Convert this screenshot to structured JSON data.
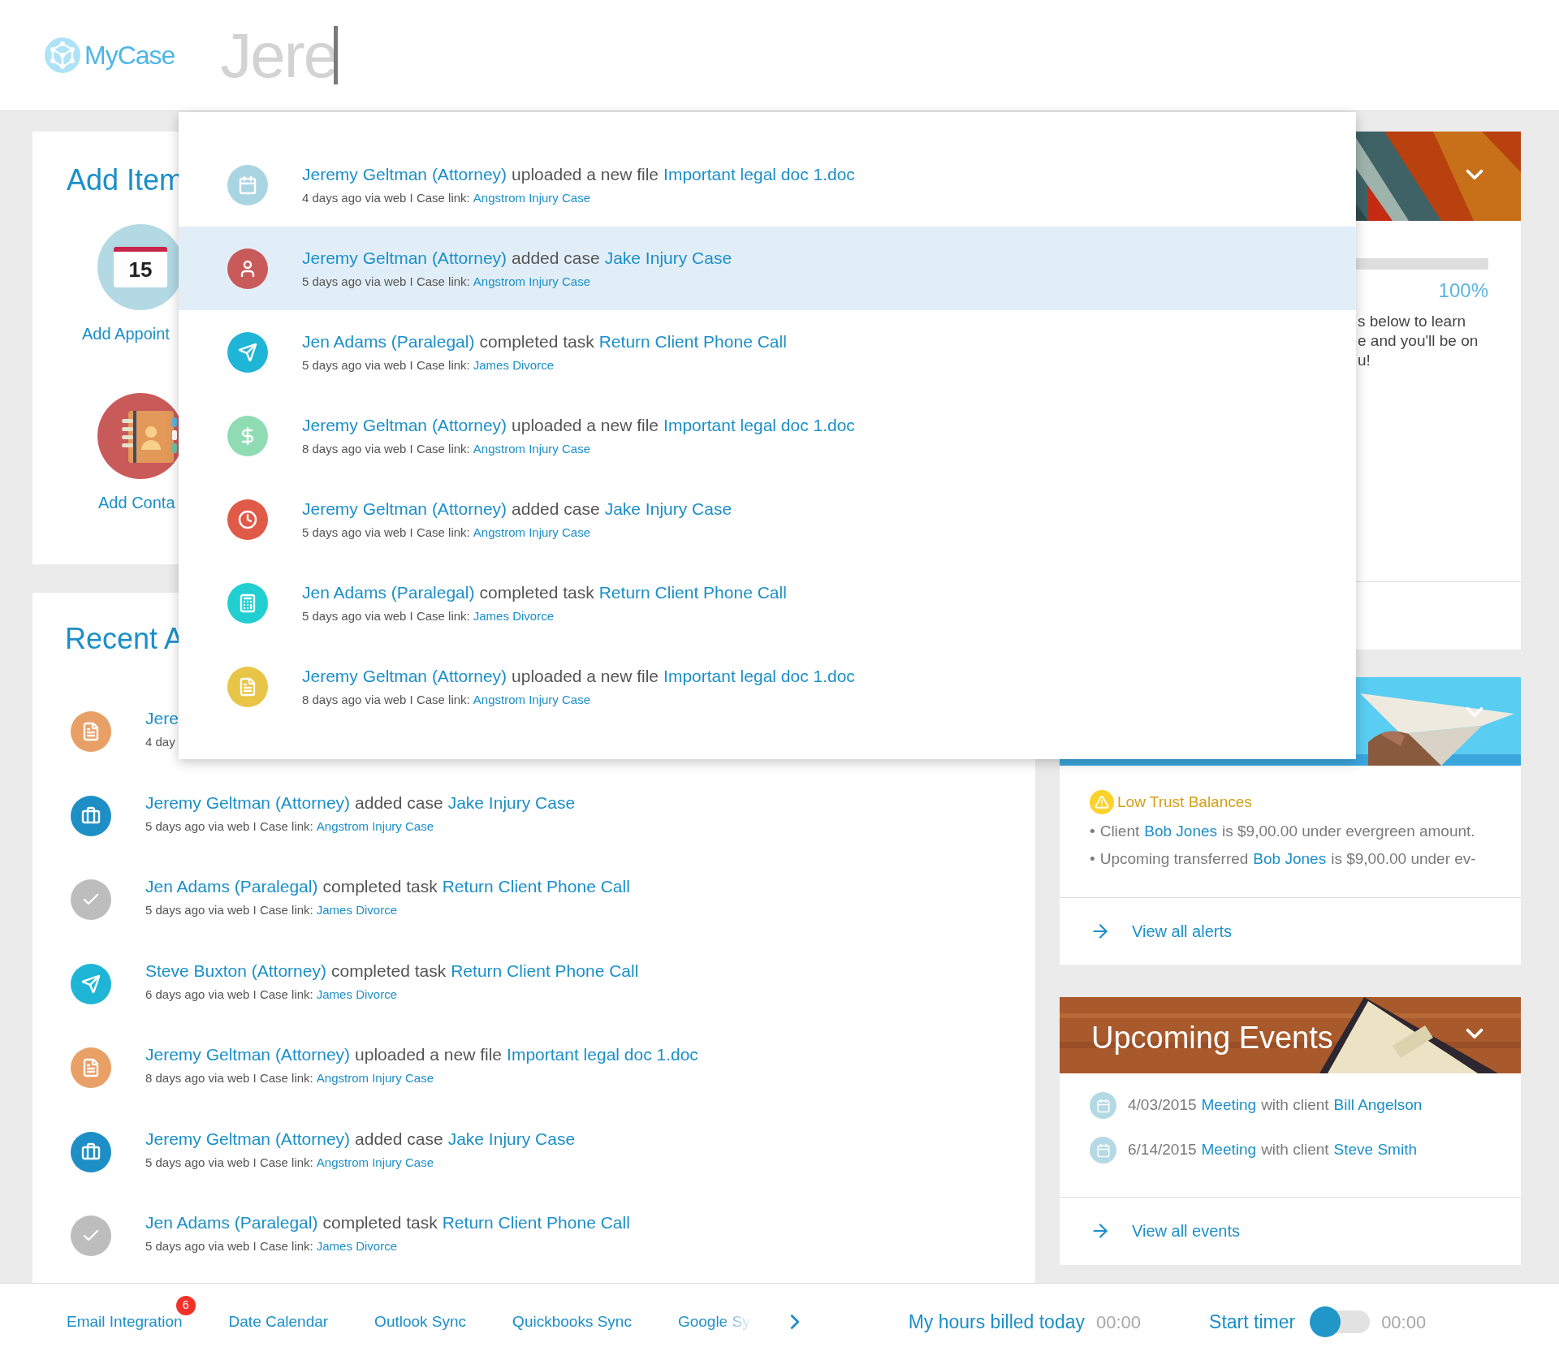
{
  "header": {
    "brand": "MyCase",
    "search": {
      "value": "Jere"
    }
  },
  "add_item": {
    "title": "Add Item",
    "items": [
      {
        "kind": "calendar",
        "day": "15",
        "label": "Add Appoint"
      },
      {
        "kind": "contacts",
        "label": "Add Conta"
      }
    ]
  },
  "recent_activity": {
    "title": "Recent A",
    "items": [
      {
        "kind": "file",
        "color": "#e8a066",
        "actor": "Jere",
        "meta": "4 day"
      },
      {
        "kind": "briefcase",
        "color": "#1e8fc6",
        "actor": "Jeremy Geltman (Attorney)",
        "action": "added case",
        "object": "Jake Injury Case",
        "meta": "5 days ago via web I Case link:",
        "case_link": "Angstrom Injury Case"
      },
      {
        "kind": "check",
        "color": "#bdbdbd",
        "actor": "Jen Adams (Paralegal)",
        "action": "completed task",
        "object": "Return Client Phone Call",
        "meta": "5 days ago via web I Case link:",
        "case_link": "James Divorce"
      },
      {
        "kind": "plane",
        "color": "#1fb5d6",
        "actor": "Steve Buxton (Attorney)",
        "action": "completed task",
        "object": "Return Client Phone Call",
        "meta": "6 days ago via web I Case link:",
        "case_link": "James Divorce"
      },
      {
        "kind": "file",
        "color": "#e8a066",
        "actor": "Jeremy Geltman (Attorney)",
        "action": "uploaded a new file",
        "object": "Important legal doc 1.doc",
        "meta": "8 days ago via web I Case link:",
        "case_link": "Angstrom Injury Case"
      },
      {
        "kind": "briefcase",
        "color": "#1e8fc6",
        "actor": "Jeremy Geltman (Attorney)",
        "action": "added case",
        "object": "Jake Injury Case",
        "meta": "5 days ago via web I Case link:",
        "case_link": "Angstrom Injury Case"
      },
      {
        "kind": "check",
        "color": "#bdbdbd",
        "actor": "Jen Adams (Paralegal)",
        "action": "completed task",
        "object": "Return Client Phone Call",
        "meta": "5 days ago via web I Case link:",
        "case_link": "James Divorce"
      }
    ]
  },
  "search_results": [
    {
      "kind": "calendar",
      "color": "#a9d5e2",
      "selected": false,
      "actor": "Jeremy Geltman (Attorney)",
      "action": "uploaded a new file",
      "object": "Important legal doc 1.doc",
      "meta": "4 days ago via web I Case link:",
      "case_link": "Angstrom Injury Case"
    },
    {
      "kind": "person",
      "color": "#c95a5a",
      "selected": true,
      "actor": "Jeremy Geltman (Attorney)",
      "action": "added case",
      "object": "Jake Injury Case",
      "meta": "5 days ago via web I Case link:",
      "case_link": "Angstrom Injury Case"
    },
    {
      "kind": "plane",
      "color": "#1fb5d6",
      "selected": false,
      "actor": "Jen Adams (Paralegal)",
      "action": "completed task",
      "object": "Return Client Phone Call",
      "meta": "5 days ago via web I Case link:",
      "case_link": "James Divorce"
    },
    {
      "kind": "dollar",
      "color": "#8fdcb4",
      "selected": false,
      "actor": "Jeremy Geltman (Attorney)",
      "action": "uploaded a new file",
      "object": "Important legal doc 1.doc",
      "meta": "8 days ago via web I Case link:",
      "case_link": "Angstrom Injury Case"
    },
    {
      "kind": "clock",
      "color": "#e05a48",
      "selected": false,
      "actor": "Jeremy Geltman (Attorney)",
      "action": "added case",
      "object": "Jake Injury Case",
      "meta": "5 days ago via web I Case link:",
      "case_link": "Angstrom Injury Case"
    },
    {
      "kind": "calculator",
      "color": "#22cfd0",
      "selected": false,
      "actor": "Jen Adams (Paralegal)",
      "action": "completed task",
      "object": "Return Client Phone Call",
      "meta": "5 days ago via web I Case link:",
      "case_link": "James Divorce"
    },
    {
      "kind": "file",
      "color": "#e8c547",
      "selected": false,
      "actor": "Jeremy Geltman (Attorney)",
      "action": "uploaded a new file",
      "object": "Important legal doc 1.doc",
      "meta": "8 days ago via web I Case link:",
      "case_link": "Angstrom Injury Case"
    }
  ],
  "welcome": {
    "progress": {
      "level": 1,
      "reading": "100%"
    },
    "text_lines": [
      "s below to learn",
      "e and you'll be on",
      "u!"
    ]
  },
  "alerts": {
    "title": "Low Trust Balances",
    "items": [
      {
        "bullet": "•",
        "before": "Client",
        "link": "Bob Jones",
        "after": "is $9,00.00 under evergreen amount."
      },
      {
        "bullet": "•",
        "before": "Upcoming transferred",
        "link": "Bob Jones",
        "after": "is $9,00.00 under ev-"
      }
    ],
    "view_all": "View all alerts"
  },
  "events": {
    "title": "Upcoming Events",
    "items": [
      {
        "date": "4/03/2015",
        "link": "Meeting",
        "middle": "with client",
        "client": "Bill Angelson"
      },
      {
        "date": "6/14/2015",
        "link": "Meeting",
        "middle": "with client",
        "client": "Steve Smith"
      }
    ],
    "view_all": "View all events"
  },
  "bottom_bar": {
    "links": [
      {
        "label": "Email Integration",
        "badge": "6",
        "faded": false
      },
      {
        "label": "Date Calendar",
        "faded": false
      },
      {
        "label": "Outlook Sync",
        "faded": false
      },
      {
        "label": "Quickbooks Sync",
        "faded": false
      },
      {
        "label": "Google Sy",
        "faded": true
      }
    ],
    "hours_label": "My hours billed today",
    "hours_value": "00:00",
    "timer_label": "Start timer",
    "timer": {
      "on": false
    },
    "timer_value": "00:00"
  }
}
